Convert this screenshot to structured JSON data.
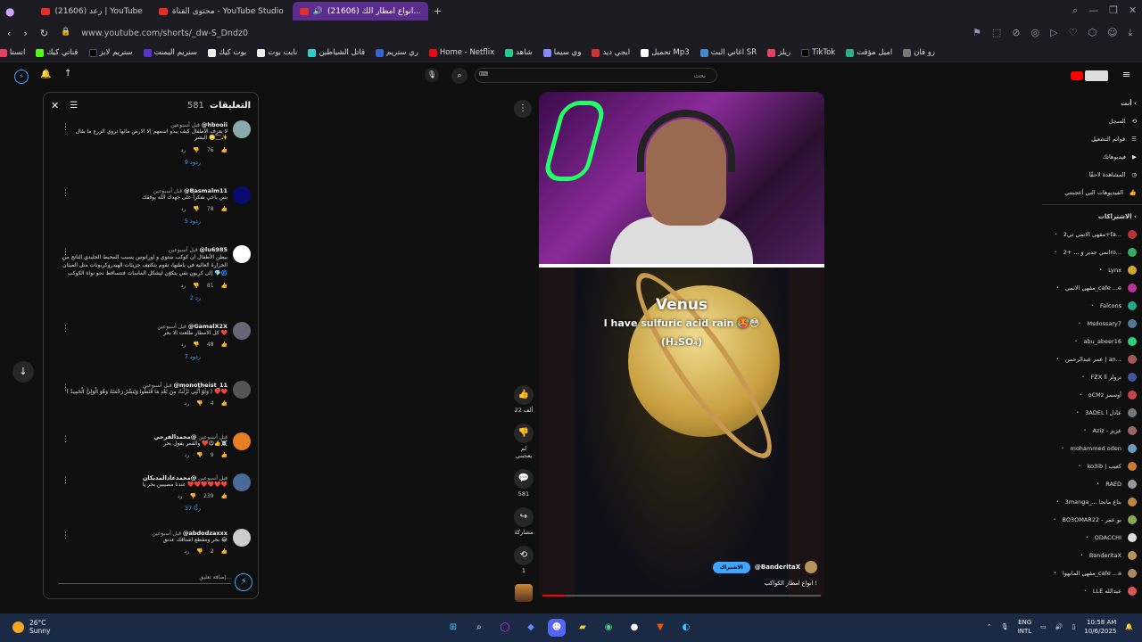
{
  "tabs": [
    {
      "label": "رعد (21606) | YouTube"
    },
    {
      "label": "محتوى القناة - YouTube Studio"
    },
    {
      "label": "(21606) انواع امطار الك..."
    }
  ],
  "address": {
    "url": "www.youtube.com/shorts/_dw-S_Dndz0"
  },
  "bookmarks": [
    "زو فان",
    "اميل مؤقت",
    "TikTok",
    "ريلز",
    "اغاني البث SR",
    "تحميل Mp3",
    "ايجي ديد",
    "وي سيما",
    "شاهد",
    "Home - Netflix",
    "ري ستريم",
    "قاتل الشياطين",
    "نايت بوت",
    "بوت كيك",
    "ستريم اليمنت",
    "ستريم لابز",
    "قناتي كيك",
    "انستا"
  ],
  "search": {
    "placeholder": "بحث"
  },
  "comments_panel": {
    "title": "التعليقات",
    "count": "581",
    "input_placeholder": "إضافة تعليق...",
    "items": [
      {
        "user": "@hbooii",
        "time": "قبل أسبوعين",
        "text": "لا يعرف الأطفال كيف يبدو اسمهم إلا الارض مائها تروي الزرع ما بقال البشر 🙄🏻✨",
        "likes": "76",
        "replies": "9 ردود",
        "reply_btn": "رد"
      },
      {
        "user": "@Basmalm11",
        "time": "قبل أسبوعين",
        "text": "بس ياخي شكراً على جهدك الله يوفقك",
        "likes": "78",
        "replies": "5 ردود",
        "reply_btn": "رد"
      },
      {
        "user": "@lu6985",
        "time": "قبل أسبوعين",
        "text": "بيظن الأطفال ان كوكب ستوي و اورانوس يسبب المحيط الجليدي الناتج من الحرارة العالية في باطنها، تقوم بتكثيف جزيئات الهيدروكربونات مثل الميثان إلى كربون نقي يتكوّن ليشكل الماسات فتتساقط نحو نواة الكوكب 💎🌀",
        "likes": "81",
        "replies": "رد 2",
        "reply_btn": "رد"
      },
      {
        "user": "@GamalX2X",
        "time": "قبل أسبوعين",
        "text": "كل الامطار طلعت الا بحر ❤️",
        "likes": "48",
        "replies": "7 ردود",
        "reply_btn": "رد"
      },
      {
        "user": "@monotheist_11",
        "time": "قبل أسبوعين",
        "text": "( وَلَوْ أَنَّنِي نَزَّلْتُ مِنَ بَعْدِ مَا قَنَطُوا وَيَنشُرُ رَحْمَتَهُ وَهُوَ الْوَلِيُّ الْحَمِيدُ ) ❤️❤️",
        "likes": "4",
        "replies": "",
        "reply_btn": "رد"
      },
      {
        "user": "@محمدالفرحي",
        "time": "قبل أسبوعين",
        "text": "والقمر يقول بحر ❤️😍👍☠️",
        "likes": "9",
        "replies": "",
        "reply_btn": "رد"
      },
      {
        "user": "@محمدعادالمدبكان",
        "time": "قبل أسبوعين",
        "text": "عندنا مصيبين بحر يا ❤️❤️❤️❤️❤️❤️",
        "likes": "239",
        "replies": "37 ردًّا",
        "reply_btn": "رد"
      },
      {
        "user": "@abdodzaxxx",
        "time": "قبل أسبوعين",
        "text": "بحر ومقطع اشتاقك عدنق 😂",
        "likes": "2",
        "replies": "",
        "reply_btn": "رد"
      }
    ]
  },
  "video": {
    "title": "Venus",
    "caption": "I have sulfuric acid rain 🥵😳",
    "formula": "(H₂SO₄)",
    "channel": "@BanderitaX",
    "subscribe": "الاشتراك",
    "description": "انواع امطار الكواكب !",
    "progress": 0.08
  },
  "actions": [
    {
      "icon": "👍",
      "label": "22 ألف"
    },
    {
      "icon": "👎",
      "label": "لم يعجبني"
    },
    {
      "icon": "💬",
      "label": "581"
    },
    {
      "icon": "↪",
      "label": "مشاركة"
    },
    {
      "icon": "⟲",
      "label": "1"
    }
  ],
  "sidebar": {
    "you_header": "أنت",
    "you_items": [
      "السجل",
      "قوائم التشغيل",
      "فيديوهاتك",
      "المشاهدة لاحقًا",
      "الفيديوهات التي أعجبتني"
    ],
    "subs_header": "الاشتراكات",
    "subs": [
      {
        "name": "مقهى الانمي تي2+fa...",
        "color": "#b33"
      },
      {
        "name": "انمي جدير و ... +2ro...",
        "color": "#3a6"
      },
      {
        "name": "Lynx",
        "color": "#ca3"
      },
      {
        "name": "مقهى الانمي_cafe ...e",
        "color": "#b39"
      },
      {
        "name": "Falcons",
        "color": "#2a8"
      },
      {
        "name": "Msdossary7",
        "color": "#579"
      },
      {
        "name": "abu_abeer16",
        "color": "#3c7"
      },
      {
        "name": "عمر عبدالرحمن | an...",
        "color": "#a55"
      },
      {
        "name": "FZX ll ترولز",
        "color": "#459"
      },
      {
        "name": "oCMz أوسمز",
        "color": "#c44"
      },
      {
        "name": "3ADEL l عادل",
        "color": "#777"
      },
      {
        "name": "Aziz - عزيز",
        "color": "#966"
      },
      {
        "name": "mohammed oden",
        "color": "#69b"
      },
      {
        "name": "ko3ib | كعيب",
        "color": "#c73"
      },
      {
        "name": "RAED",
        "color": "#999"
      },
      {
        "name": "3manga_... بتاع مانجا",
        "color": "#b84"
      },
      {
        "name": "BO3OMAR22 - بو عمر",
        "color": "#8a5"
      },
      {
        "name": "ODACCHI",
        "color": "#ddd"
      },
      {
        "name": "BanderitaX",
        "color": "#b8945a"
      },
      {
        "name": "مقهى المانهوا_cafe ...a",
        "color": "#a86"
      },
      {
        "name": "LLE عبدالله",
        "color": "#d55"
      }
    ]
  },
  "taskbar": {
    "temp": "26°C",
    "weather": "Sunny",
    "lang1": "ENG",
    "lang2": "INTL",
    "time": "10:58 AM",
    "date": "10/6/2025"
  }
}
